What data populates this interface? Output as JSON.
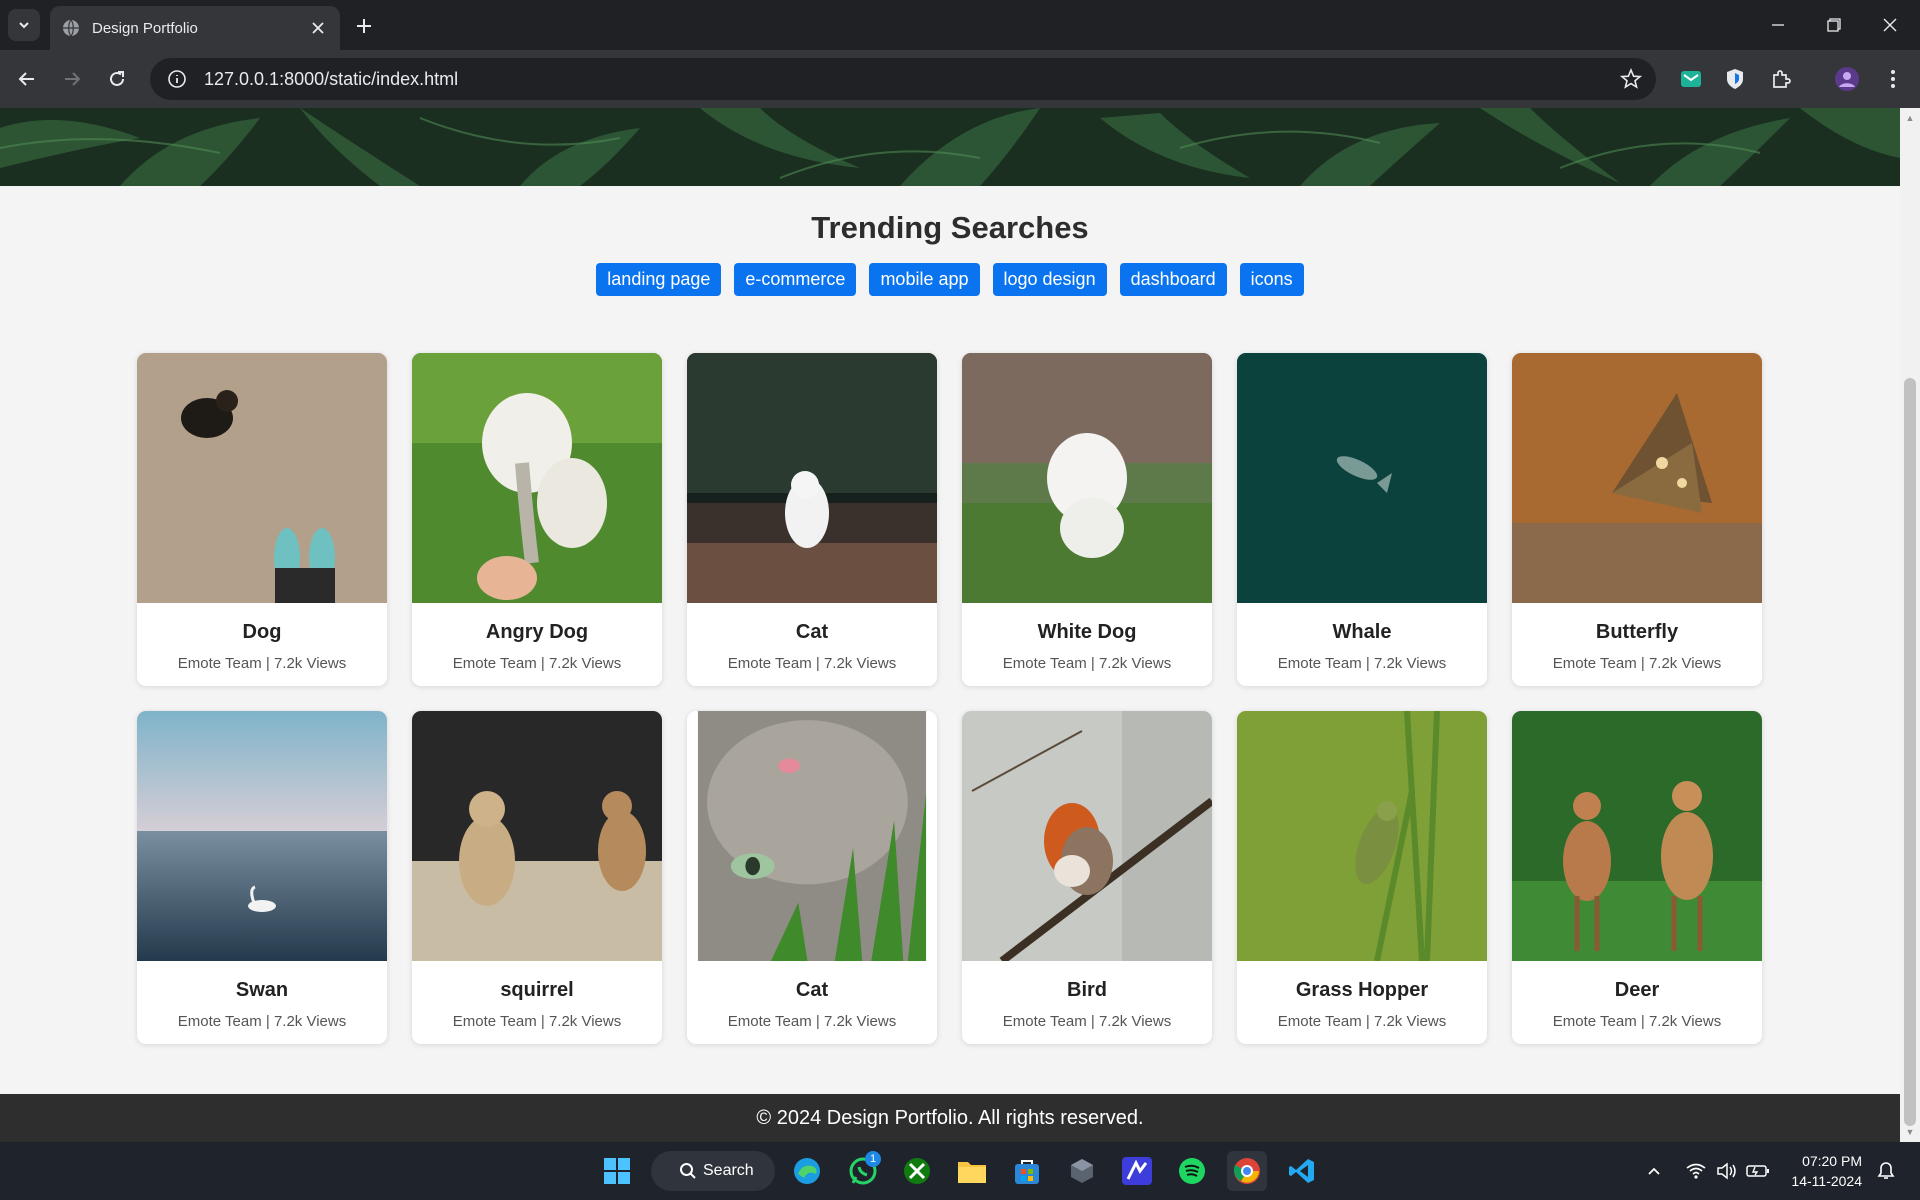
{
  "browser": {
    "tab_title": "Design Portfolio",
    "url": "127.0.0.1:8000/static/index.html"
  },
  "page": {
    "heading": "Trending Searches",
    "tags": [
      "landing page",
      "e-commerce",
      "mobile app",
      "logo design",
      "dashboard",
      "icons"
    ],
    "cards": [
      {
        "name": "Dog",
        "meta": "Emote Team | 7.2k Views"
      },
      {
        "name": "Angry Dog",
        "meta": "Emote Team | 7.2k Views"
      },
      {
        "name": "Cat",
        "meta": "Emote Team | 7.2k Views"
      },
      {
        "name": "White Dog",
        "meta": "Emote Team | 7.2k Views"
      },
      {
        "name": "Whale",
        "meta": "Emote Team | 7.2k Views"
      },
      {
        "name": "Butterfly",
        "meta": "Emote Team | 7.2k Views"
      },
      {
        "name": "Swan",
        "meta": "Emote Team | 7.2k Views"
      },
      {
        "name": "squirrel",
        "meta": "Emote Team | 7.2k Views"
      },
      {
        "name": "Cat",
        "meta": "Emote Team | 7.2k Views"
      },
      {
        "name": "Bird",
        "meta": "Emote Team | 7.2k Views"
      },
      {
        "name": "Grass Hopper",
        "meta": "Emote Team | 7.2k Views"
      },
      {
        "name": "Deer",
        "meta": "Emote Team | 7.2k Views"
      }
    ],
    "footer": "© 2024 Design Portfolio. All rights reserved."
  },
  "taskbar": {
    "search_label": "Search",
    "whatsapp_badge": "1",
    "time": "07:20 PM",
    "date": "14-11-2024"
  },
  "colors": {
    "accent": "#0a74f0",
    "footer_bg": "#2e2e2e",
    "chrome_bg": "#202124"
  }
}
